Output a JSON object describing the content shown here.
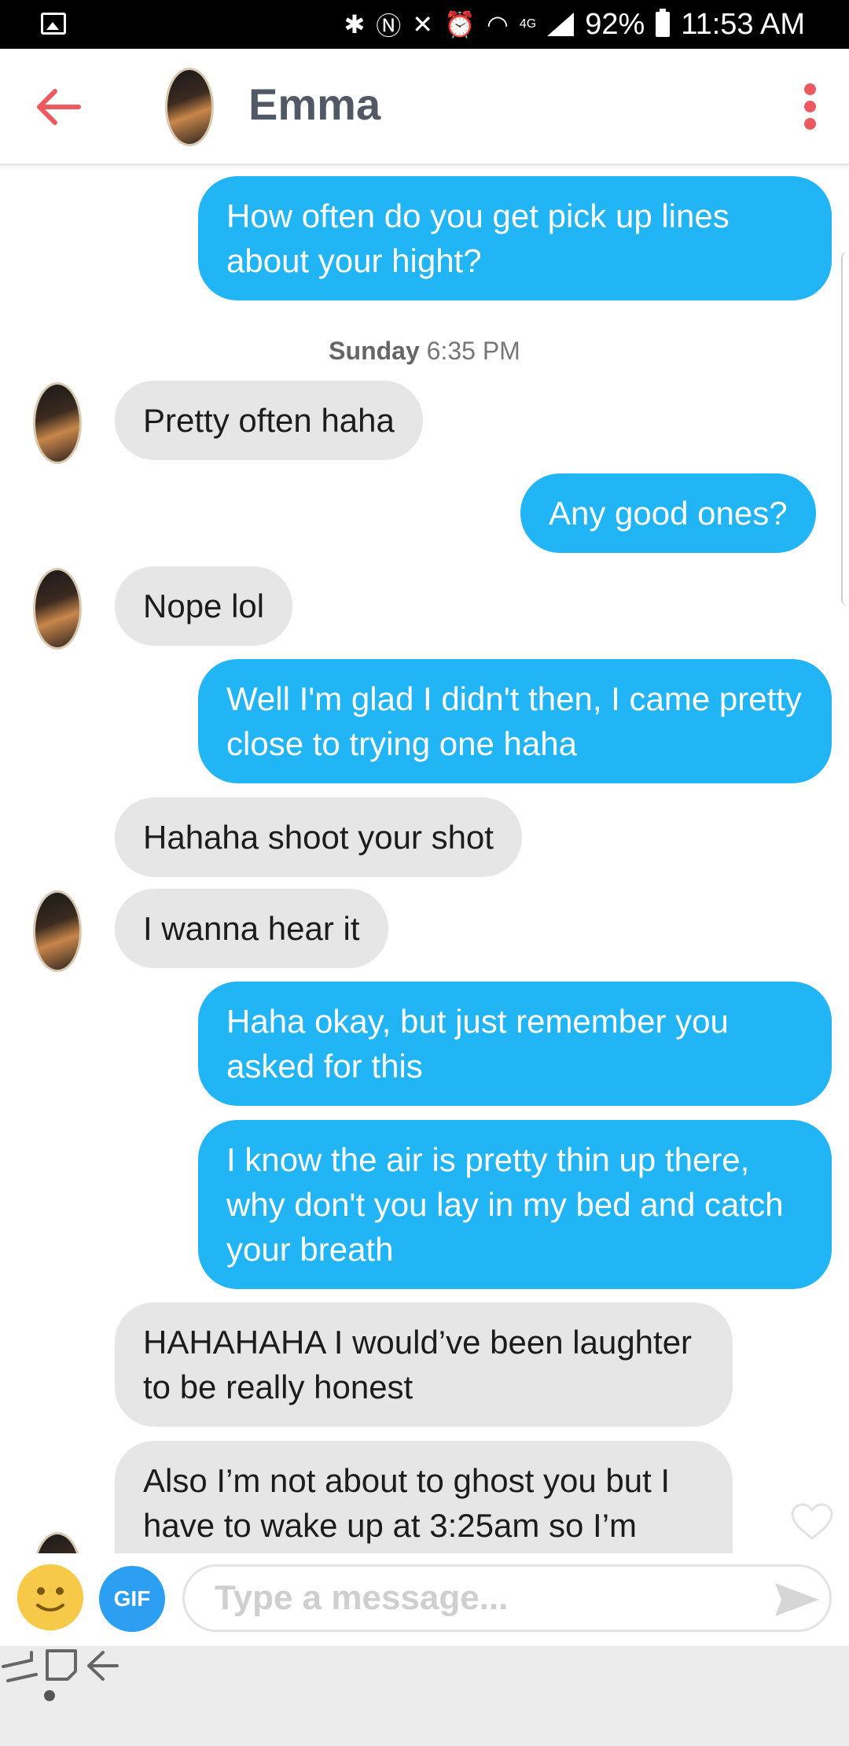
{
  "status_bar": {
    "battery": "92%",
    "time": "11:53 AM",
    "network": "4G"
  },
  "header": {
    "contact_name": "Emma"
  },
  "messages": {
    "m1": "How often do you get pick up lines about your hight?",
    "timestamp_day": "Sunday",
    "timestamp_time": "6:35 PM",
    "m2": "Pretty often haha",
    "m3": "Any good ones?",
    "m4": "Nope lol",
    "m5": "Well I'm glad I didn't then, I came pretty close to trying one haha",
    "m6": "Hahaha shoot your shot",
    "m7": "I wanna hear it",
    "m8": "Haha okay, but just remember you asked for this",
    "m9": "I know the air is pretty thin up there, why don't you lay in my bed and catch your breath",
    "m10": "HAHAHAHA I would’ve been laughter to be really honest",
    "m11": "Also I’m not about to ghost you but I have to wake up at 3:25am so I’m"
  },
  "composer": {
    "gif_label": "GIF",
    "placeholder": "Type a message..."
  },
  "colors": {
    "outgoing": "#22b5f6",
    "incoming": "#e6e6e6",
    "accent": "#ec5a5f",
    "gif": "#2d9ff2"
  },
  "icons": {
    "back": "arrow-left",
    "menu": "vertical-dots",
    "like": "heart-outline",
    "emoji": "smiley",
    "send": "paper-plane"
  }
}
